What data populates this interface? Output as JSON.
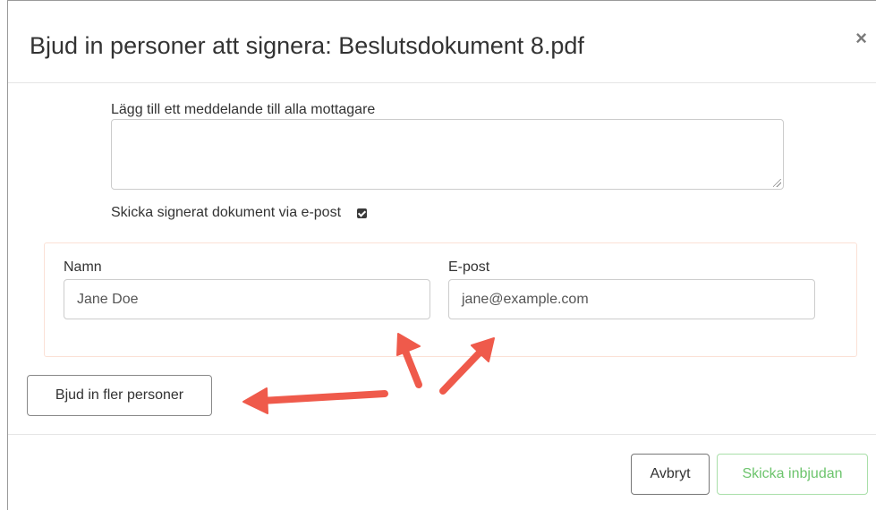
{
  "dialog": {
    "title": "Bjud in personer att signera: Beslutsdokument 8.pdf",
    "close_label": "×"
  },
  "message": {
    "label": "Lägg till ett meddelande till alla mottagare",
    "value": ""
  },
  "email_option": {
    "label": "Skicka signerat dokument via e-post",
    "checked": true
  },
  "person": {
    "name_label": "Namn",
    "name_value": "Jane Doe",
    "email_label": "E-post",
    "email_value": "jane@example.com"
  },
  "buttons": {
    "invite_more": "Bjud in fler personer",
    "cancel": "Avbryt",
    "send": "Skicka inbjudan"
  },
  "colors": {
    "annotation_arrow": "#ef5a4b",
    "send_button": "#6cc46c",
    "person_box_border": "#fbe1d6"
  }
}
